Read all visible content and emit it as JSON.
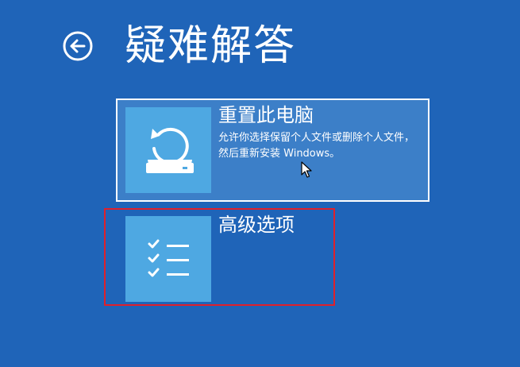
{
  "header": {
    "title": "疑难解答",
    "back_icon": "back-arrow-icon"
  },
  "options": [
    {
      "title": "重置此电脑",
      "description": "允许你选择保留个人文件或删除个人文件，然后重新安装 Windows。",
      "icon": "reset-pc-icon",
      "state": "hovered"
    },
    {
      "title": "高级选项",
      "description": "",
      "icon": "checklist-icon",
      "state": "highlighted"
    }
  ],
  "colors": {
    "background": "#1f64b8",
    "hover_background": "#3c7fc8",
    "tile": "#4ea8e2",
    "highlight_border": "#e0202b",
    "text": "#ffffff"
  }
}
